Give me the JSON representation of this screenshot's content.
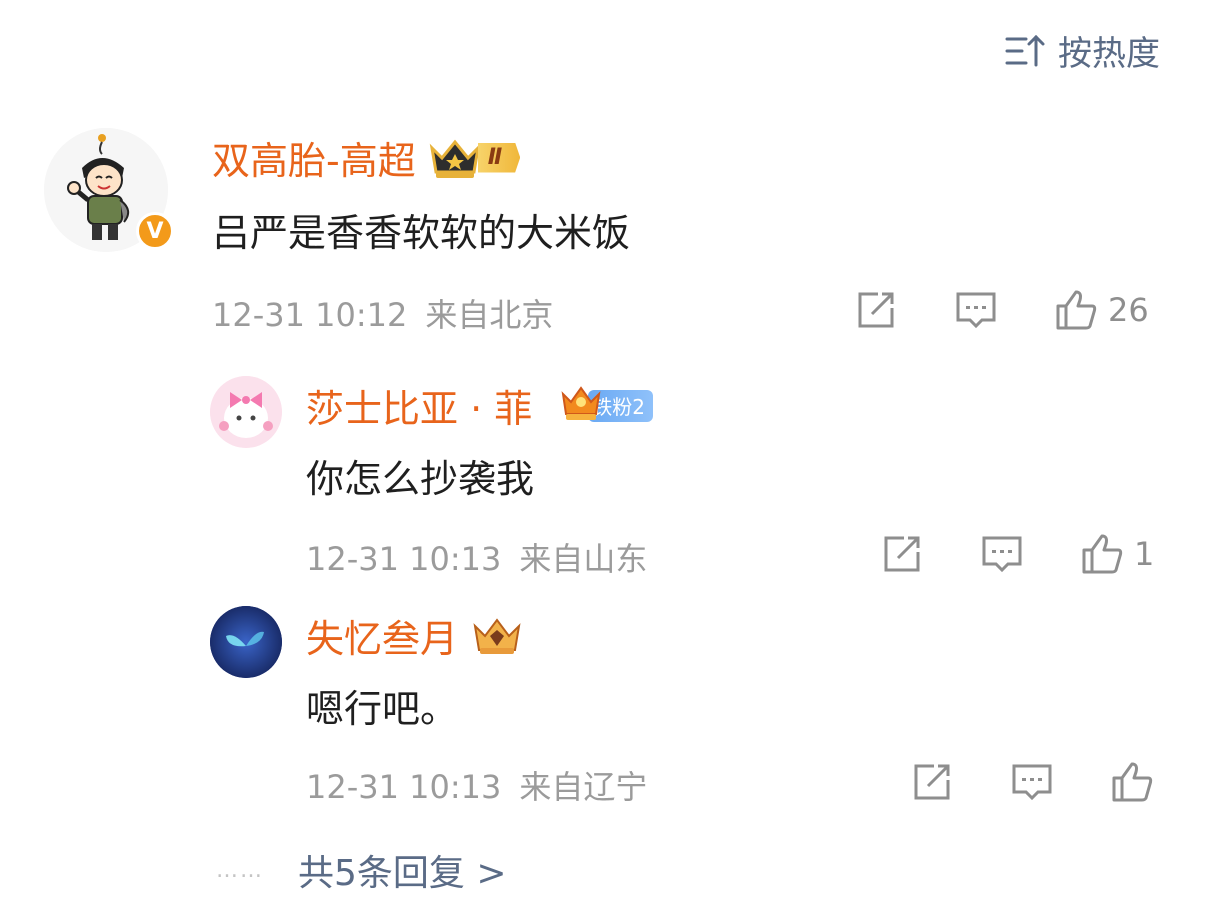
{
  "sort": {
    "label": "按热度"
  },
  "comments": [
    {
      "username": "双高胎-高超",
      "badge_text": "Ⅱ",
      "verified": "V",
      "content": "吕严是香香软软的大米饭",
      "time": "12-31 10:12",
      "location": "来自北京",
      "likes": "26"
    },
    {
      "username": "莎士比亚 · 菲",
      "badge_text": "铁粉2",
      "content": "你怎么抄袭我",
      "time": "12-31 10:13",
      "location": "来自山东",
      "likes": "1"
    },
    {
      "username": "失忆叁月",
      "content": "嗯行吧。",
      "time": "12-31 10:13",
      "location": "来自辽宁",
      "likes": ""
    }
  ],
  "more_replies": {
    "dots": "……",
    "label": "共5条回复 >"
  },
  "colors": {
    "username": "#e8641b",
    "link": "#5a6b86",
    "meta": "#9b9b9b"
  },
  "icons": [
    "sort-icon",
    "share-icon",
    "comment-icon",
    "like-icon",
    "crown-icon",
    "verified-icon"
  ]
}
